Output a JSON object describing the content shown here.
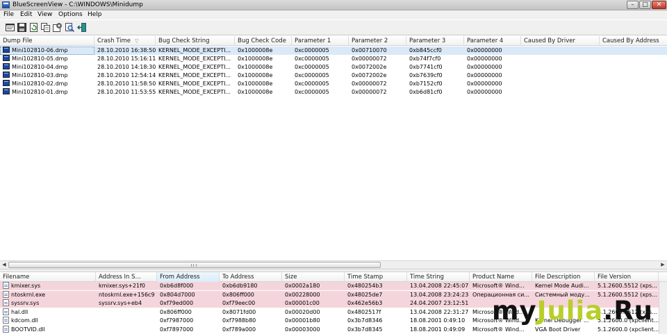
{
  "window": {
    "title": "BlueScreenView  -  C:\\WINDOWS\\Minidump",
    "buttons": {
      "minimize": "–",
      "maximize": "□",
      "close": "✕"
    }
  },
  "menu": {
    "items": [
      "File",
      "Edit",
      "View",
      "Options",
      "Help"
    ]
  },
  "toolbar": {
    "buttons": [
      "properties-icon",
      "save-icon",
      "refresh-icon",
      "copy-icon",
      "advanced-options-icon",
      "find-icon",
      "exit-icon"
    ]
  },
  "crash_list": {
    "columns": [
      "Dump File",
      "Crash Time",
      "Bug Check String",
      "Bug Check Code",
      "Parameter 1",
      "Parameter 2",
      "Parameter 3",
      "Parameter 4",
      "Caused By Driver",
      "Caused By Address"
    ],
    "sort_column": "Crash Time",
    "sort_indicator": "▽",
    "rows": [
      [
        "Mini102810-06.dmp",
        "28.10.2010 16:38:50",
        "KERNEL_MODE_EXCEPTI...",
        "0x1000008e",
        "0xc0000005",
        "0x00710070",
        "0xb845ccf0",
        "0x00000000",
        "",
        ""
      ],
      [
        "Mini102810-05.dmp",
        "28.10.2010 15:16:11",
        "KERNEL_MODE_EXCEPTI...",
        "0x1000008e",
        "0xc0000005",
        "0x00000072",
        "0xb74f7cf0",
        "0x00000000",
        "",
        ""
      ],
      [
        "Mini102810-04.dmp",
        "28.10.2010 14:18:30",
        "KERNEL_MODE_EXCEPTI...",
        "0x1000008e",
        "0xc0000005",
        "0x0072002e",
        "0xb7741cf0",
        "0x00000000",
        "",
        ""
      ],
      [
        "Mini102810-03.dmp",
        "28.10.2010 12:54:14",
        "KERNEL_MODE_EXCEPTI...",
        "0x1000008e",
        "0xc0000005",
        "0x0072002e",
        "0xb7639cf0",
        "0x00000000",
        "",
        ""
      ],
      [
        "Mini102810-02.dmp",
        "28.10.2010 11:58:50",
        "KERNEL_MODE_EXCEPTI...",
        "0x1000008e",
        "0xc0000005",
        "0x00000072",
        "0xb7152cf0",
        "0x00000000",
        "",
        ""
      ],
      [
        "Mini102810-01.dmp",
        "28.10.2010 11:53:55",
        "KERNEL_MODE_EXCEPTI...",
        "0x1000008e",
        "0xc0000005",
        "0x00000072",
        "0xb6d81cf0",
        "0x00000000",
        "",
        ""
      ]
    ],
    "selected_row": 0
  },
  "scrollbar": {
    "left_arrow": "◀",
    "right_arrow": "▶"
  },
  "driver_list": {
    "columns": [
      "Filename",
      "Address In S...",
      "From Address",
      "To Address",
      "Size",
      "Time Stamp",
      "Time String",
      "Product Name",
      "File Description",
      "File Version"
    ],
    "sort_column": "From Address",
    "rows": [
      {
        "highlight": true,
        "cells": [
          "kmixer.sys",
          "kmixer.sys+21f0",
          "0xb6d8f000",
          "0xb6db9180",
          "0x0002a180",
          "0x480254b3",
          "13.04.2008 22:45:07",
          "Microsoft® Wind...",
          "Kernel Mode Audi...",
          "5.1.2600.5512 (xps..."
        ]
      },
      {
        "highlight": true,
        "cells": [
          "ntoskrnl.exe",
          "ntoskrnl.exe+156c9",
          "0x804d7000",
          "0x806ff000",
          "0x00228000",
          "0x48025de7",
          "13.04.2008 23:24:23",
          "Операционная си...",
          "Системный моду...",
          "5.1.2600.5512 (xps..."
        ]
      },
      {
        "highlight": true,
        "cells": [
          "syssrv.sys",
          "syssrv.sys+eb4",
          "0xf79ed000",
          "0xf79eec00",
          "0x00001c00",
          "0x462e56b3",
          "24.04.2007 23:12:51",
          "",
          "",
          ""
        ]
      },
      {
        "highlight": false,
        "cells": [
          "hal.dll",
          "",
          "0x806ff000",
          "0x8071fd00",
          "0x00020d00",
          "0x4802517f",
          "13.04.2008 22:31:27",
          "Microsoft® Wind...",
          "",
          "5.1.2600.5512 (xps..."
        ]
      },
      {
        "highlight": false,
        "cells": [
          "kdcom.dll",
          "",
          "0xf7987000",
          "0xf7988b80",
          "0x00001b80",
          "0x3b7d8346",
          "18.08.2001 0:49:10",
          "Microsoft® Wind...",
          "Kernel Debugger ...",
          "5.1.2600.0 (xpclient..."
        ]
      },
      {
        "highlight": false,
        "cells": [
          "BOOTVID.dll",
          "",
          "0xf7897000",
          "0xf789a000",
          "0x00003000",
          "0x3b7d8345",
          "18.08.2001 0:49:09",
          "Microsoft® Wind...",
          "VGA Boot Driver",
          "5.1.2600.0 (xpclient..."
        ]
      }
    ]
  },
  "watermark": {
    "part1": "my",
    "part2": "Julia",
    "part3": ".Ru"
  },
  "colors": {
    "selected_row": "#d9e9f8",
    "highlight_row": "#f5d5dc",
    "watermark_accent": "#b8cf2a"
  }
}
